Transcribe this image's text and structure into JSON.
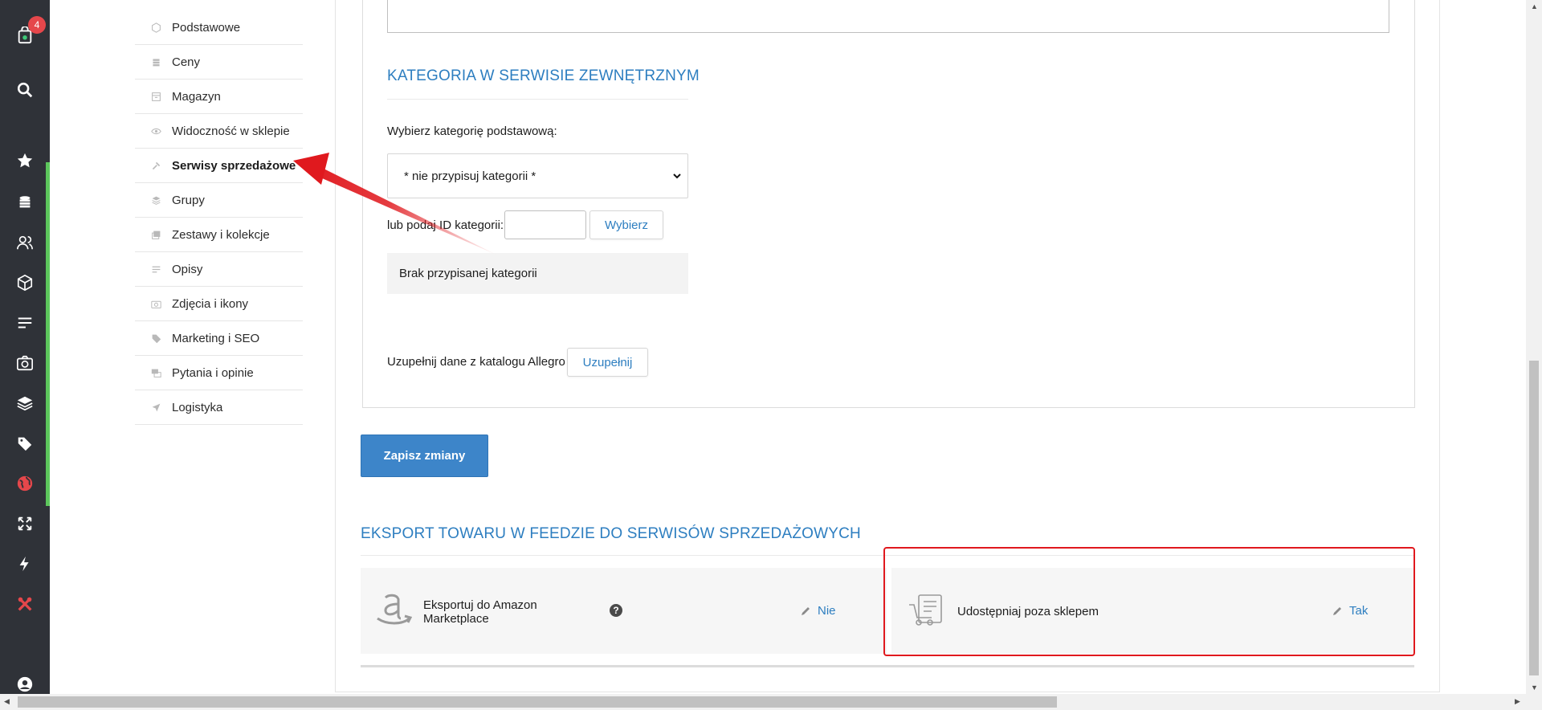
{
  "rail": {
    "badge_count": "4",
    "items": [
      {
        "name": "shop-bag-icon"
      },
      {
        "name": "search-icon"
      },
      {
        "name": "star-icon"
      },
      {
        "name": "coins-icon"
      },
      {
        "name": "users-icon"
      },
      {
        "name": "box-icon"
      },
      {
        "name": "list-icon"
      },
      {
        "name": "camera-icon"
      },
      {
        "name": "layers-icon"
      },
      {
        "name": "tags-icon"
      },
      {
        "name": "globe-icon"
      },
      {
        "name": "expand-icon"
      },
      {
        "name": "bolt-icon"
      },
      {
        "name": "tools-icon"
      },
      {
        "name": "user-circle-icon"
      }
    ],
    "accent_color": "#5cc65c"
  },
  "submenu": {
    "items": [
      {
        "label": "Podstawowe",
        "icon": "cube-icon"
      },
      {
        "label": "Ceny",
        "icon": "coins-icon"
      },
      {
        "label": "Magazyn",
        "icon": "archive-icon"
      },
      {
        "label": "Widoczność w sklepie",
        "icon": "eye-icon"
      },
      {
        "label": "Serwisy sprzedażowe",
        "icon": "gavel-icon",
        "active": true
      },
      {
        "label": "Grupy",
        "icon": "layers-icon"
      },
      {
        "label": "Zestawy i kolekcje",
        "icon": "collection-icon"
      },
      {
        "label": "Opisy",
        "icon": "text-icon"
      },
      {
        "label": "Zdjęcia i ikony",
        "icon": "camera-icon"
      },
      {
        "label": "Marketing i SEO",
        "icon": "tags-icon"
      },
      {
        "label": "Pytania i opinie",
        "icon": "comments-icon"
      },
      {
        "label": "Logistyka",
        "icon": "send-icon"
      }
    ]
  },
  "category_section": {
    "title": "KATEGORIA W SERWISIE ZEWNĘTRZNYM",
    "select_label": "Wybierz kategorię podstawową:",
    "select_value": "* nie przypisuj kategorii *",
    "id_label": "lub podaj ID kategorii:",
    "id_value": "",
    "choose_button": "Wybierz",
    "no_category": "Brak przypisanej kategorii",
    "allegro_label": "Uzupełnij dane z katalogu Allegro",
    "allegro_button": "Uzupełnij"
  },
  "save_button": "Zapisz zmiany",
  "export_section": {
    "title": "EKSPORT TOWARU W FEEDZIE DO SERWISÓW SPRZEDAŻOWYCH",
    "amazon": {
      "label_line1": "Eksportuj do Amazon",
      "label_line2": "Marketplace",
      "help": "?",
      "value": "Nie"
    },
    "share": {
      "label": "Udostępniaj poza sklepem",
      "value": "Tak"
    }
  },
  "colors": {
    "link": "#2d7ec0",
    "primary_button": "#3d85c9",
    "highlight_red": "#e0191e"
  }
}
